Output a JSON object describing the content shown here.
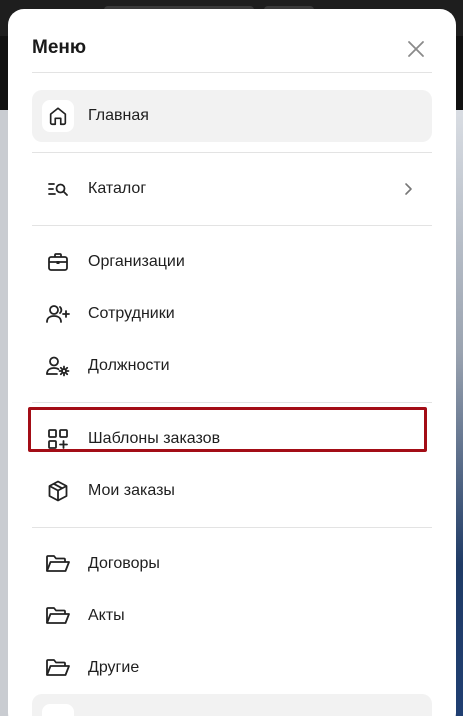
{
  "modal": {
    "title": "Меню"
  },
  "menu": {
    "home": {
      "label": "Главная",
      "icon": "home-icon",
      "active": true
    },
    "catalog": {
      "label": "Каталог",
      "icon": "catalog-search-icon"
    },
    "organizations": {
      "label": "Организации",
      "icon": "briefcase-icon"
    },
    "employees": {
      "label": "Сотрудники",
      "icon": "user-plus-icon"
    },
    "positions": {
      "label": "Должности",
      "icon": "user-gear-icon"
    },
    "order_templates": {
      "label": "Шаблоны заказов",
      "icon": "grid-plus-icon"
    },
    "my_orders": {
      "label": "Мои заказы",
      "icon": "package-icon"
    },
    "contracts": {
      "label": "Договоры",
      "icon": "folder-icon"
    },
    "acts": {
      "label": "Акты",
      "icon": "folder-icon"
    },
    "other": {
      "label": "Другие",
      "icon": "folder-icon"
    }
  },
  "colors": {
    "highlight": "#a30d16",
    "active_bg": "#f2f2f2"
  }
}
